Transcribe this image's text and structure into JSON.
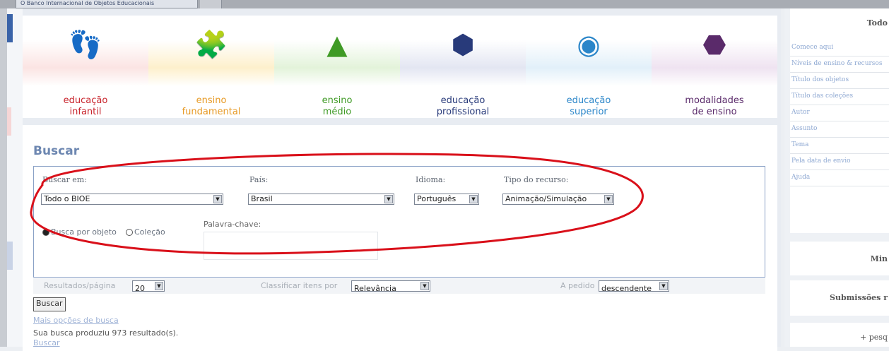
{
  "tab": {
    "title": "O Banco Internacional de Objetos Educacionais"
  },
  "categories": [
    {
      "line1": "educação",
      "line2": "infantil",
      "color": "#c8232b",
      "band": "#fbe4e3",
      "icon": "footprints-icon",
      "glyph": "👣"
    },
    {
      "line1": "ensino",
      "line2": "fundamental",
      "color": "#e79a25",
      "band": "#fdf0cc",
      "icon": "puzzle-icon",
      "glyph": "🧩"
    },
    {
      "line1": "ensino",
      "line2": "médio",
      "color": "#3f9a25",
      "band": "#e3f3da",
      "icon": "pyramid-icon",
      "glyph": "▲"
    },
    {
      "line1": "educação",
      "line2": "profissional",
      "color": "#283a7a",
      "band": "#e3e6f2",
      "icon": "cube-icon",
      "glyph": "⬢"
    },
    {
      "line1": "educação",
      "line2": "superior",
      "color": "#2b86c9",
      "band": "#e2f0f9",
      "icon": "sphere-icon",
      "glyph": "◉"
    },
    {
      "line1": "modalidades",
      "line2": "de ensino",
      "color": "#5a2a6a",
      "band": "#efe3f1",
      "icon": "polygon-icon",
      "glyph": "⬣"
    }
  ],
  "search": {
    "title": "Buscar",
    "scope_label": "Buscar em:",
    "scope_value": "Todo o BIOE",
    "country_label": "País:",
    "country_value": "Brasil",
    "language_label": "Idioma:",
    "language_value": "Português",
    "type_label": "Tipo do recurso:",
    "type_value": "Animação/Simulação",
    "keyword_label": "Palavra-chave:",
    "radio_object": "Busca por objeto",
    "radio_collection": "Coleção",
    "results_label": "Resultados/página",
    "results_value": "20",
    "sort_label": "Classificar itens por",
    "sort_value": "Relevância",
    "order_label": "A pedido",
    "order_value": "descendente",
    "button": "Buscar",
    "more_options": "Mais opções de busca",
    "result_text": "Sua busca produziu 973 resultado(s).",
    "bottom_link": "Buscar"
  },
  "sidebar": {
    "heading": "Todo",
    "links": [
      "Comece aqui",
      "Níveis de ensino & recursos",
      "Título dos objetos",
      "Título das coleções",
      "Autor",
      "Assunto",
      "Tema",
      "Pela data de envio",
      "Ajuda"
    ],
    "box2": "Min",
    "box3": "Submissões r",
    "box4": "+ pesq"
  },
  "colors": {
    "accent": "#6d87b1",
    "annotation": "#d9101a"
  }
}
